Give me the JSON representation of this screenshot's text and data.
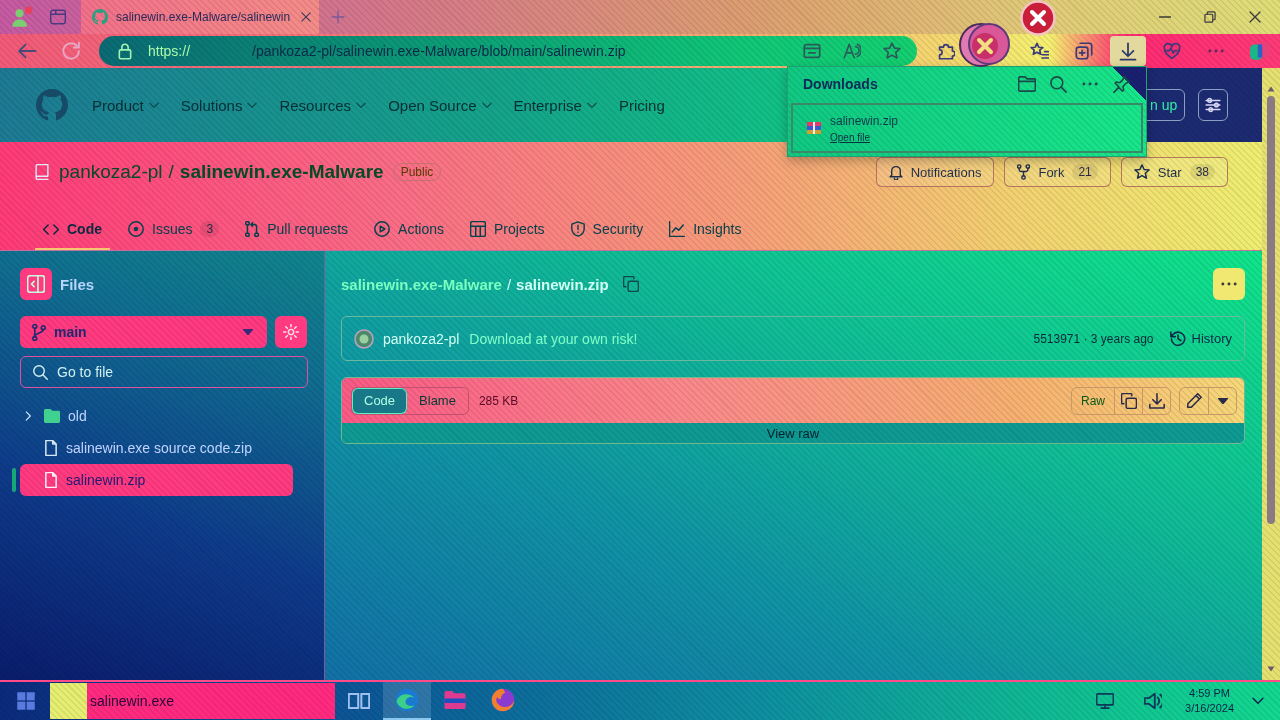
{
  "browser": {
    "tabs": [
      {
        "title": "salinewin.exe-Malware/salinewin",
        "selected": true
      }
    ],
    "address": {
      "scheme": "https://",
      "path": "/pankoza2-pl/salinewin.exe-Malware/blob/main/salinewin.zip"
    },
    "downloads_button": {
      "selected": true
    }
  },
  "site_header": {
    "nav": [
      {
        "label": "Product",
        "has_menu": true
      },
      {
        "label": "Solutions",
        "has_menu": true
      },
      {
        "label": "Resources",
        "has_menu": true
      },
      {
        "label": "Open Source",
        "has_menu": true
      },
      {
        "label": "Enterprise",
        "has_menu": true
      },
      {
        "label": "Pricing",
        "has_menu": false
      }
    ],
    "sign_up": "n up"
  },
  "repo": {
    "owner": "pankoza2-pl",
    "separator": "/",
    "name": "salinewin.exe-Malware",
    "visibility": "Public",
    "actions": [
      {
        "kind": "notifications",
        "label": "Notifications"
      },
      {
        "kind": "fork",
        "label": "Fork",
        "count": "21"
      },
      {
        "kind": "star",
        "label": "Star",
        "count": "38"
      }
    ],
    "tabs": [
      {
        "kind": "code",
        "label": "Code",
        "selected": true
      },
      {
        "kind": "issues",
        "label": "Issues",
        "count": "3",
        "selected": false
      },
      {
        "kind": "pulls",
        "label": "Pull requests",
        "selected": false
      },
      {
        "kind": "actions",
        "label": "Actions",
        "selected": false
      },
      {
        "kind": "projects",
        "label": "Projects",
        "selected": false
      },
      {
        "kind": "security",
        "label": "Security",
        "selected": false
      },
      {
        "kind": "insights",
        "label": "Insights",
        "selected": false
      }
    ]
  },
  "sidebar": {
    "title": "Files",
    "branch": "main",
    "search": {
      "placeholder": "Go to file"
    },
    "tree": [
      {
        "kind": "folder",
        "name": "old",
        "expanded": false,
        "selected": false
      },
      {
        "kind": "file",
        "name": "salinewin.exe source code.zip",
        "selected": false
      },
      {
        "kind": "file",
        "name": "salinewin.zip",
        "selected": true
      }
    ]
  },
  "file": {
    "breadcrumb": {
      "repo": "salinewin.exe-Malware",
      "separator": "/",
      "file": "salinewin.zip"
    },
    "commit": {
      "author": "pankoza2-pl",
      "message": "Download at your own risk!",
      "meta": "5513971 · 3 years ago",
      "history": "History"
    },
    "view_modes": [
      {
        "label": "Code",
        "selected": true
      },
      {
        "label": "Blame",
        "selected": false
      }
    ],
    "size": "285 KB",
    "raw": "Raw",
    "body": "View raw"
  },
  "downloads": {
    "title": "Downloads",
    "items": [
      {
        "name": "salinewin.zip",
        "action": "Open file"
      }
    ]
  },
  "taskbar": {
    "search": {
      "value": "salinewin.exe"
    },
    "apps": [
      {
        "kind": "browser",
        "selected": true
      },
      {
        "kind": "files",
        "selected": false
      },
      {
        "kind": "firefox",
        "selected": false
      }
    ],
    "clock": {
      "time": "4:59 PM",
      "date": "3/16/2024"
    }
  }
}
